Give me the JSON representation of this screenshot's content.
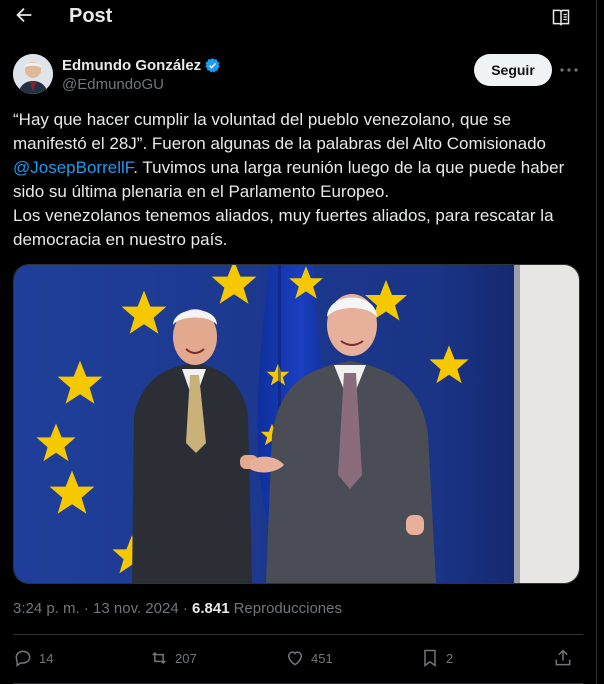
{
  "header": {
    "title": "Post",
    "back_icon": "arrow-left-icon",
    "reader_icon": "reader-mode-icon"
  },
  "author": {
    "name": "Edmundo González",
    "handle": "@EdmundoGU",
    "verified_icon": "verified-badge-icon",
    "verified_color": "#1d9bf0",
    "follow_label": "Seguir",
    "more_icon": "more-dots-icon"
  },
  "post": {
    "line1_a": "“Hay que hacer cumplir la voluntad del pueblo venezolano, que se manifestó el 28J”. Fueron algunas de la palabras del Alto Comisionado ",
    "mention": "@JosepBorrellF",
    "line1_b": ". Tuvimos una larga reunión luego de la que puede haber sido su última plenaria en el Parlamento Europeo.",
    "line2": "Los venezolanos tenemos aliados, muy fuertes aliados, para rescatar la democracia en nuestro país.",
    "mention_color": "#1d9bf0"
  },
  "meta": {
    "time": "3:24 p. m.",
    "dot": " · ",
    "date": "13 nov. 2024",
    "views_count": "6.841",
    "views_label": "Reproducciones"
  },
  "actions": {
    "replies": "14",
    "reposts": "207",
    "likes": "451",
    "bookmarks": "2",
    "reply_icon": "reply-icon",
    "repost_icon": "repost-icon",
    "like_icon": "heart-icon",
    "bookmark_icon": "bookmark-icon",
    "share_icon": "share-icon"
  },
  "colors": {
    "background": "#000000",
    "text": "#e7e9ea",
    "muted": "#71767b",
    "divider": "#2f3336",
    "accent": "#1d9bf0"
  }
}
